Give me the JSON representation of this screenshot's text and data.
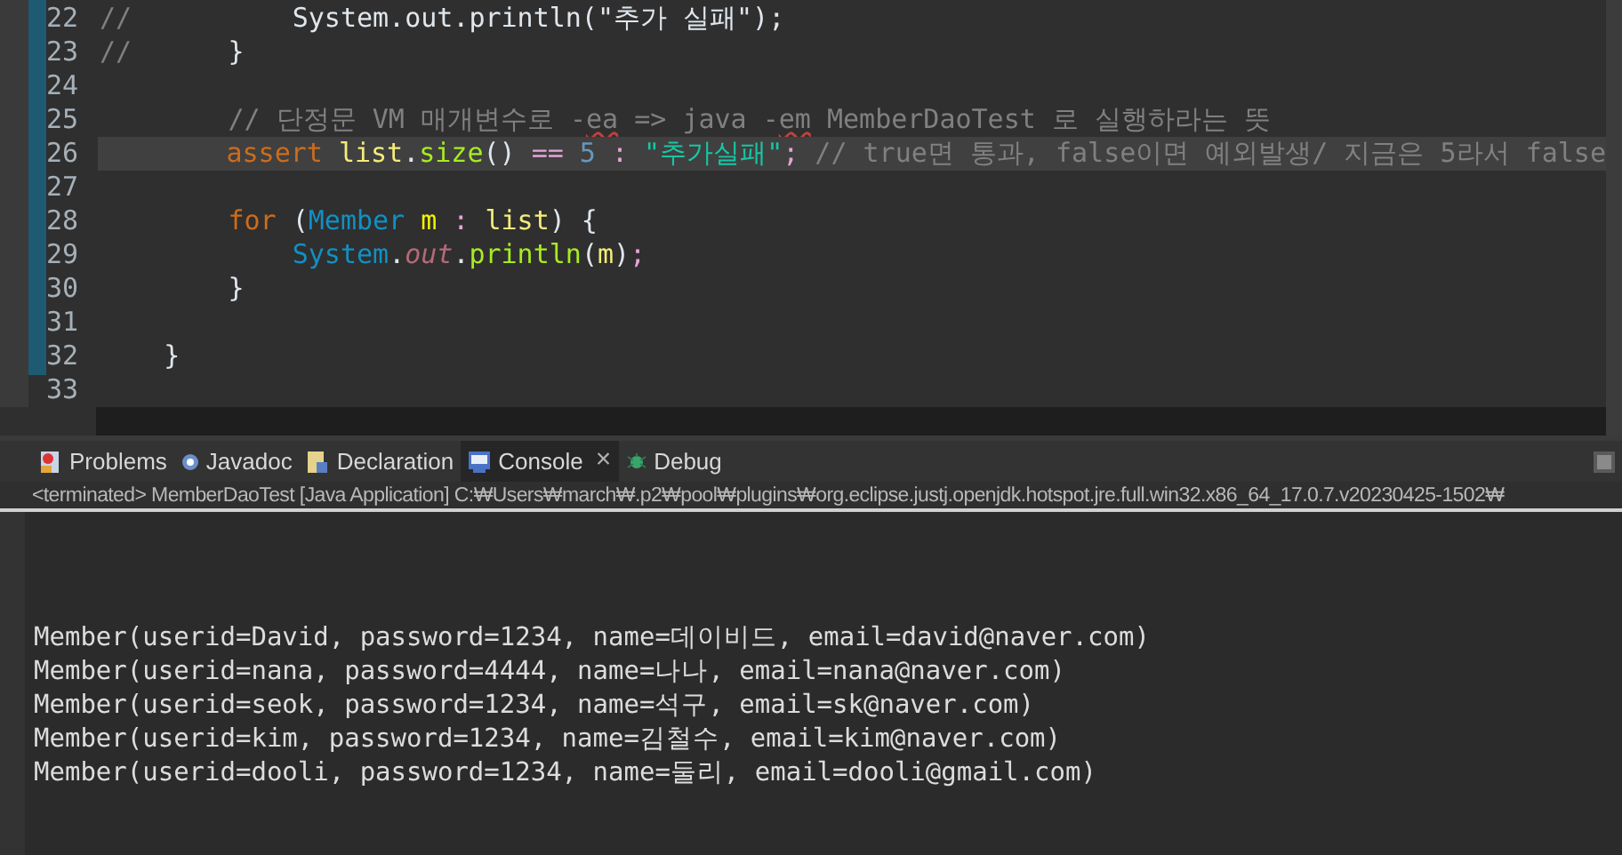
{
  "editor": {
    "lines": [
      {
        "number": "22",
        "current": false,
        "tokens": [
          {
            "kind": "comment",
            "text": "//"
          },
          {
            "kind": "plain",
            "text": "          System.out.println(\"추가 실패\");"
          }
        ]
      },
      {
        "number": "23",
        "current": false,
        "tokens": [
          {
            "kind": "comment",
            "text": "//"
          },
          {
            "kind": "plain",
            "text": "      }"
          }
        ]
      },
      {
        "number": "24",
        "current": false
      },
      {
        "number": "25",
        "current": false,
        "tokens": [
          {
            "kind": "comment",
            "text": "        // 단정문 VM 매개변수로 -"
          },
          {
            "kind": "misspelled",
            "text": "ea"
          },
          {
            "kind": "comment",
            "text": " => java -"
          },
          {
            "kind": "misspelled",
            "text": "em"
          },
          {
            "kind": "comment",
            "text": " MemberDaoTest 로 실행하라는 뜻"
          }
        ]
      },
      {
        "number": "26",
        "current": true,
        "tokens": [
          {
            "kind": "keyword",
            "text": "        assert"
          },
          {
            "kind": "variable",
            "text": " list"
          },
          {
            "kind": "plain",
            "text": "."
          },
          {
            "kind": "method",
            "text": "size"
          },
          {
            "kind": "plain",
            "text": "() "
          },
          {
            "kind": "operator",
            "text": "=="
          },
          {
            "kind": "number",
            "text": " 5"
          },
          {
            "kind": "operator",
            "text": " :"
          },
          {
            "kind": "string",
            "text": " \"추가실패\""
          },
          {
            "kind": "operator",
            "text": ";"
          },
          {
            "kind": "comment",
            "text": " // true면 통과, false이면 예외발생/ 지금은 5라서 false"
          }
        ]
      },
      {
        "number": "27",
        "current": false
      },
      {
        "number": "28",
        "current": false,
        "tokens": [
          {
            "kind": "keyword",
            "text": "        for"
          },
          {
            "kind": "plain",
            "text": " ("
          },
          {
            "kind": "type",
            "text": "Member"
          },
          {
            "kind": "declaration",
            "text": " m"
          },
          {
            "kind": "operator",
            "text": " :"
          },
          {
            "kind": "variable",
            "text": " list"
          },
          {
            "kind": "plain",
            "text": ") {"
          }
        ]
      },
      {
        "number": "29",
        "current": false,
        "tokens": [
          {
            "kind": "type",
            "text": "            System"
          },
          {
            "kind": "plain",
            "text": "."
          },
          {
            "kind": "field",
            "text": "out"
          },
          {
            "kind": "plain",
            "text": "."
          },
          {
            "kind": "method",
            "text": "println"
          },
          {
            "kind": "plain",
            "text": "("
          },
          {
            "kind": "variable",
            "text": "m"
          },
          {
            "kind": "plain",
            "text": ")"
          },
          {
            "kind": "operator",
            "text": ";"
          }
        ]
      },
      {
        "number": "30",
        "current": false,
        "tokens": [
          {
            "kind": "plain",
            "text": "        }"
          }
        ]
      },
      {
        "number": "31",
        "current": false
      },
      {
        "number": "32",
        "current": false,
        "tokens": [
          {
            "kind": "plain",
            "text": "    }"
          }
        ]
      },
      {
        "number": "33",
        "current": false
      }
    ]
  },
  "tabs": [
    {
      "label": "Problems",
      "selected": false
    },
    {
      "label": "Javadoc",
      "selected": false
    },
    {
      "label": "Declaration",
      "selected": false
    },
    {
      "label": "Console",
      "selected": true,
      "close": "×"
    },
    {
      "label": "Debug",
      "selected": false
    }
  ],
  "console": {
    "header": "<terminated> MemberDaoTest [Java Application] C:₩Users₩march₩.p2₩pool₩plugins₩org.eclipse.justj.openjdk.hotspot.jre.full.win32.x86_64_17.0.7.v20230425-1502₩",
    "output": [
      "Member(userid=David, password=1234, name=데이비드, email=david@naver.com)",
      "Member(userid=nana, password=4444, name=나나, email=nana@naver.com)",
      "Member(userid=seok, password=1234, name=석구, email=sk@naver.com)",
      "Member(userid=kim, password=1234, name=김철수, email=kim@naver.com)",
      "Member(userid=dooli, password=1234, name=둘리, email=dooli@gmail.com)"
    ]
  }
}
